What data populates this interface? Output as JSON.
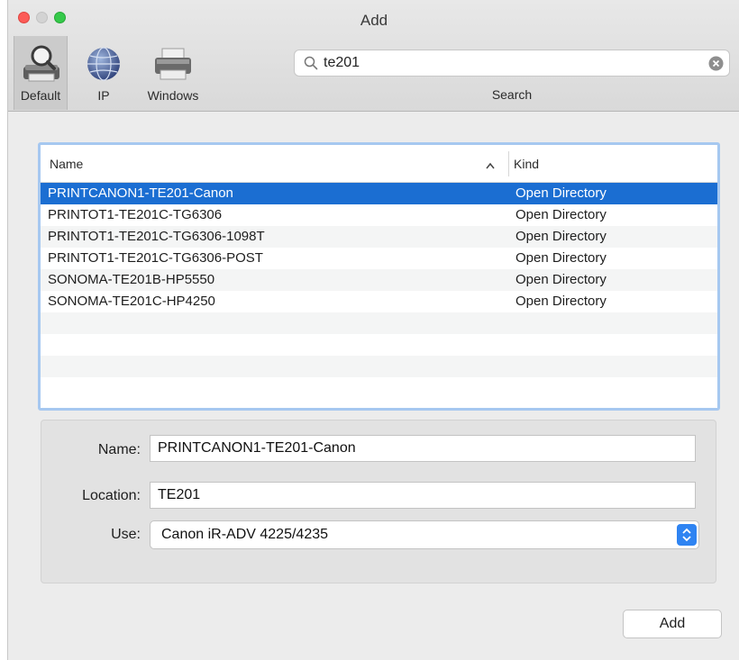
{
  "window": {
    "title": "Add"
  },
  "toolbar": {
    "default_label": "Default",
    "ip_label": "IP",
    "windows_label": "Windows",
    "search_label": "Search"
  },
  "search": {
    "value": "te201"
  },
  "list": {
    "header_name": "Name",
    "header_kind": "Kind",
    "rows": [
      {
        "name": "PRINTCANON1-TE201-Canon",
        "kind": "Open Directory",
        "selected": true
      },
      {
        "name": "PRINTOT1-TE201C-TG6306",
        "kind": "Open Directory"
      },
      {
        "name": "PRINTOT1-TE201C-TG6306-1098T",
        "kind": "Open Directory"
      },
      {
        "name": "PRINTOT1-TE201C-TG6306-POST",
        "kind": "Open Directory"
      },
      {
        "name": "SONOMA-TE201B-HP5550",
        "kind": "Open Directory"
      },
      {
        "name": "SONOMA-TE201C-HP4250",
        "kind": "Open Directory"
      }
    ],
    "empty_rows": 4
  },
  "details": {
    "name_label": "Name:",
    "name_value": "PRINTCANON1-TE201-Canon",
    "location_label": "Location:",
    "location_value": "TE201",
    "use_label": "Use:",
    "use_value": "Canon iR-ADV 4225/4235"
  },
  "buttons": {
    "add": "Add"
  },
  "colors": {
    "selection": "#1b6ed2",
    "focus_ring": "#a6c8f0",
    "popup_arrows": "#2f84f2"
  },
  "icons": {
    "default": "printer-magnifier-icon",
    "ip": "globe-icon",
    "windows": "printer-icon",
    "search": "search-icon",
    "clear": "clear-search-icon",
    "sort": "chevron-up-icon"
  }
}
